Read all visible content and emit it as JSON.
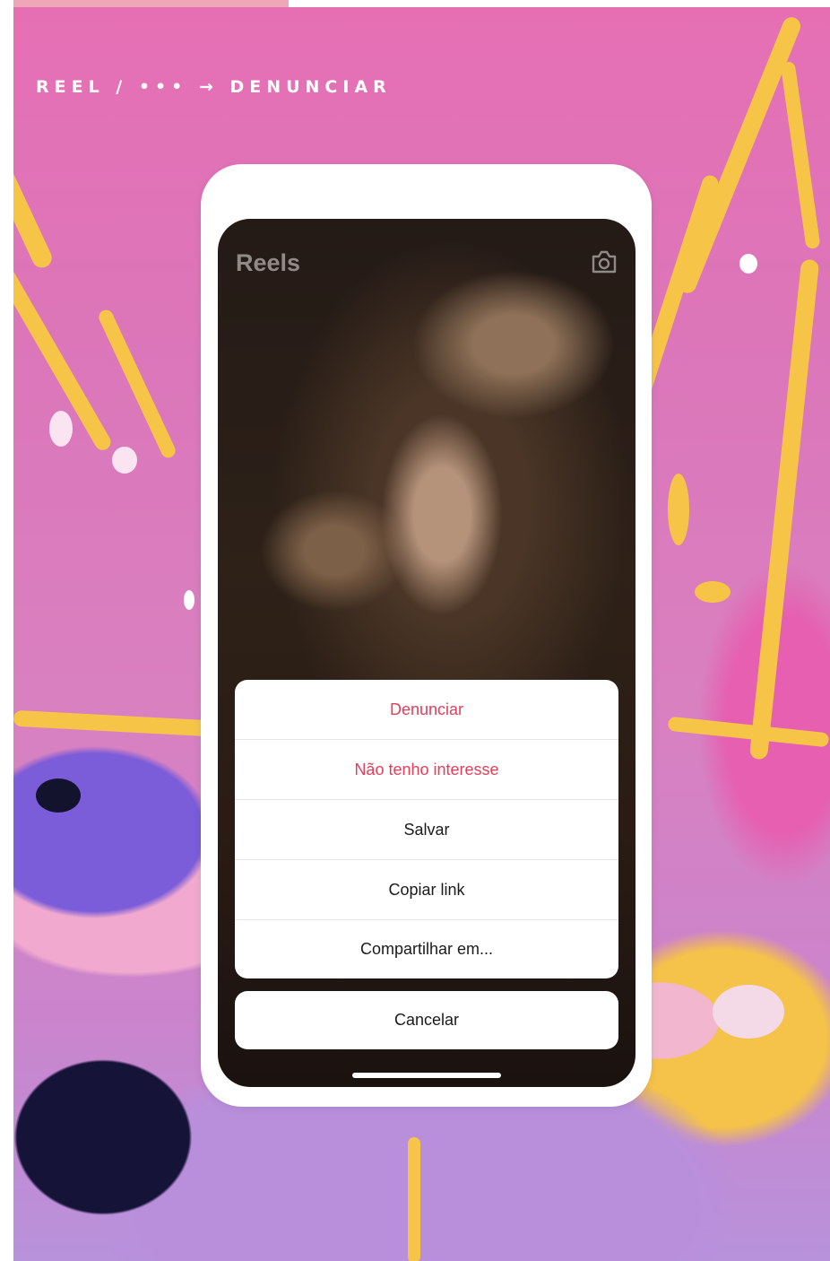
{
  "header": {
    "breadcrumb": "REEL / ••• → DENUNCIAR"
  },
  "screen": {
    "title": "Reels",
    "camera_icon": "camera-icon"
  },
  "action_sheet": {
    "items": [
      {
        "label": "Denunciar",
        "color": "#e0405b"
      },
      {
        "label": "Não tenho interesse",
        "color": "#e0405b"
      },
      {
        "label": "Salvar",
        "color": "#1b1b1b"
      },
      {
        "label": "Copiar link",
        "color": "#1b1b1b"
      },
      {
        "label": "Compartilhar em...",
        "color": "#1b1b1b"
      }
    ],
    "cancel_label": "Cancelar"
  },
  "colors": {
    "danger": "#e0405b",
    "background_pink": "#e66fb4",
    "splash_yellow": "#f6c548",
    "splash_purple": "#7b5cd9"
  }
}
